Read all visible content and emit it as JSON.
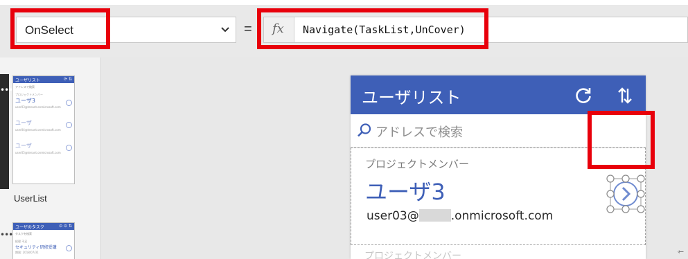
{
  "formula_bar": {
    "property": "OnSelect",
    "equals": "=",
    "fx_label": "fx",
    "formula": "Navigate(TaskList,UnCover)"
  },
  "screens_panel": {
    "screens": [
      {
        "label": "UserList",
        "thumb_title": "ユーザリスト",
        "thumb_search": "アドレスで検索",
        "thumb_lines": [
          "プロジェクトメンバー",
          "ユーザ3",
          "user03@tenant.onmicrosoft.com",
          "ユーザ",
          "user04@tenant.onmicrosoft.com",
          "ユーザ",
          "user05@tenant.onmicrosoft.com"
        ]
      },
      {
        "thumb_title": "ユーザのタスク",
        "thumb_search": "タスクを検索",
        "thumb_lines": [
          "経理  不足",
          "セキュリティ研修受講",
          "期限: 2018/07/31"
        ]
      }
    ]
  },
  "app": {
    "header_title": "ユーザリスト",
    "search_placeholder": "アドレスで検索",
    "item": {
      "subtitle": "プロジェクトメンバー",
      "name": "ユーザ3",
      "email_prefix": "user03@",
      "email_suffix": ".onmicrosoft.com"
    },
    "next_item_hint": "プロジェクトメンバー"
  },
  "icons": [
    "chevron-down-icon",
    "fx-icon",
    "refresh-icon",
    "sort-icon",
    "search-icon",
    "chevron-right-icon",
    "more-icon",
    "resize-icon"
  ],
  "colors": {
    "app_header": "#3e5fb7",
    "highlight": "#e8000b",
    "name_text": "#3e5fb7",
    "formula_bar_bg": "#e9e9e9",
    "canvas_bg": "#e8e8e8"
  }
}
